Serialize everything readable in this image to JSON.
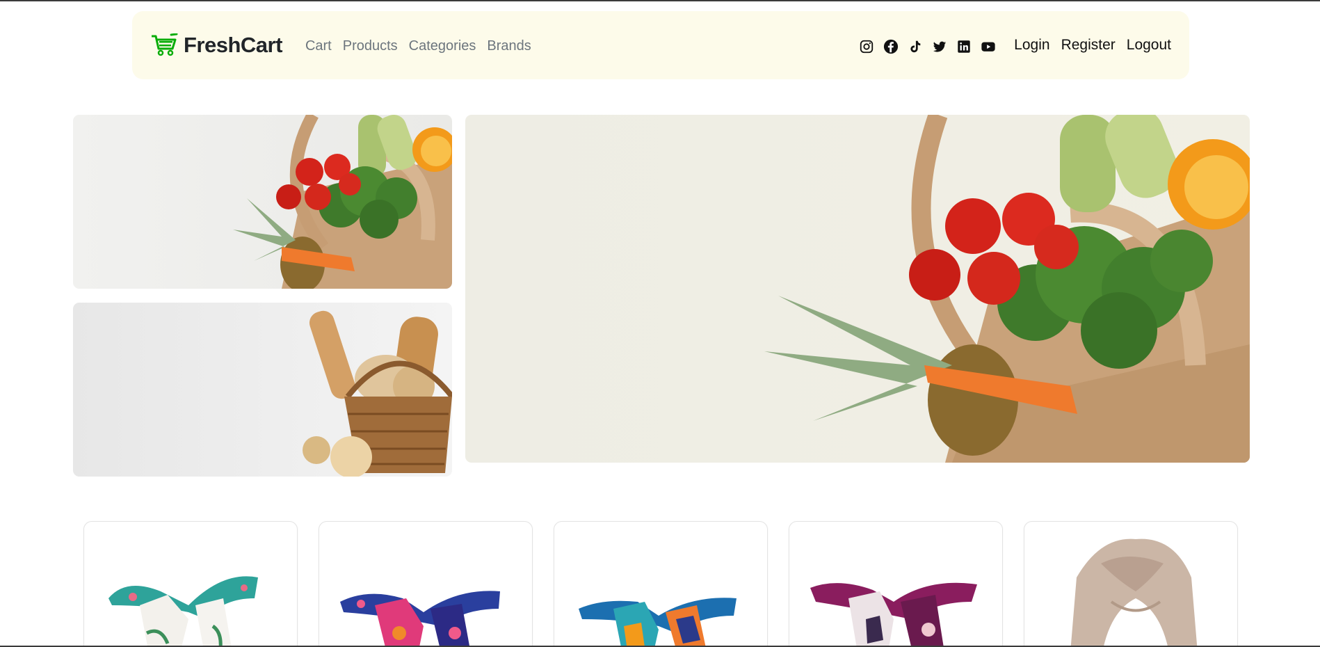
{
  "brand": {
    "name": "FreshCart",
    "icon": "cart-icon",
    "color": "#0aad0a"
  },
  "nav": {
    "links": [
      {
        "label": "Cart"
      },
      {
        "label": "Products"
      },
      {
        "label": "Categories"
      },
      {
        "label": "Brands"
      }
    ]
  },
  "socials": [
    {
      "icon": "instagram-icon"
    },
    {
      "icon": "facebook-icon"
    },
    {
      "icon": "tiktok-icon"
    },
    {
      "icon": "twitter-icon"
    },
    {
      "icon": "linkedin-icon"
    },
    {
      "icon": "youtube-icon"
    }
  ],
  "auth": {
    "login": "Login",
    "register": "Register",
    "logout": "Logout"
  },
  "hero": {
    "images": [
      {
        "subject": "grocery-bag-vegetables"
      },
      {
        "subject": "bread-basket"
      },
      {
        "subject": "grocery-bag-vegetables-large"
      }
    ]
  },
  "products": [
    {
      "subject": "white-green-floral-scarf"
    },
    {
      "subject": "pink-blue-pattern-scarf"
    },
    {
      "subject": "blue-orange-geometric-scarf"
    },
    {
      "subject": "purple-white-pattern-scarf"
    },
    {
      "subject": "beige-chiffon-scarf"
    }
  ],
  "colors": {
    "navbar_bg": "#fdfbea",
    "brand_green": "#0aad0a",
    "nav_link": "#6c757d"
  }
}
